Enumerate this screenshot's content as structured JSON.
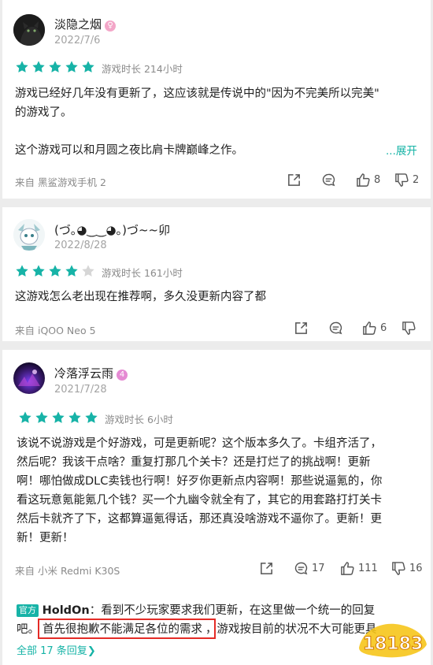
{
  "colors": {
    "accent": "#15b3a6",
    "star_on": "#17b3a7",
    "star_off": "#d6d6d6",
    "highlight": "#e42b26"
  },
  "reviews": [
    {
      "user": "淡隐之烟",
      "badge_icon": "gender-female-icon",
      "date": "2022/7/6",
      "rating": 5,
      "playtime": "游戏时长 214小时",
      "text": "游戏已经好几年没有更新了，这应该就是传说中的\"因为不完美所以完美\"\n的游戏了。\n\n这个游戏可以和月圆之夜比肩卡牌巅峰之作。",
      "expand": "...展开",
      "source": "来自 黑鲨游戏手机 2",
      "likes": "8",
      "dislikes": "2"
    },
    {
      "user": "(づ｡◕‿‿◕｡)づ~~卯",
      "date": "2022/8/28",
      "rating": 4,
      "playtime": "游戏时长 161小时",
      "text": "这游戏怎么老出现在推荐啊，多久没更新内容了都",
      "source": "来自 iQOO Neo 5",
      "likes": "6",
      "dislikes": ""
    },
    {
      "user": "冷落浮云雨",
      "badge": "4",
      "date": "2021/7/28",
      "rating": 5,
      "playtime": "游戏时长 6小时",
      "text": "该说不说游戏是个好游戏，可是更新呢？这个版本多久了。卡组齐活了，\n然后呢？我该干点啥？重复打那几个关卡？还是打烂了的挑战啊！更新\n啊！哪怕做成DLC卖钱也行啊！好歹你更新点内容啊！那些说逼氪的，你\n看这玩意氪能氪几个钱？买一个九幽令就全有了，其它的用套路打打关卡\n然后卡就齐了下，这都算逼氪得话，那还真没啥游戏不逼你了。更新！更\n新！更新！",
      "source": "来自 小米 Redmi K30S",
      "comments": "17",
      "likes": "111",
      "dislikes": "16",
      "official_reply": {
        "tag": "官方",
        "replier": "HoldOn",
        "line1": "：看到不少玩家要求我们更新，在这里做一个统一的回复",
        "line2_prefix": "吧。",
        "highlighted": "首先很抱歉不能满足各位的需求",
        "line2_suffix": "，游戏按目前的状况不大可能更具"
      },
      "all_replies": "全部 17 条回复",
      "all_replies_icon": "chevron-right-icon"
    }
  ],
  "watermark": "18183"
}
